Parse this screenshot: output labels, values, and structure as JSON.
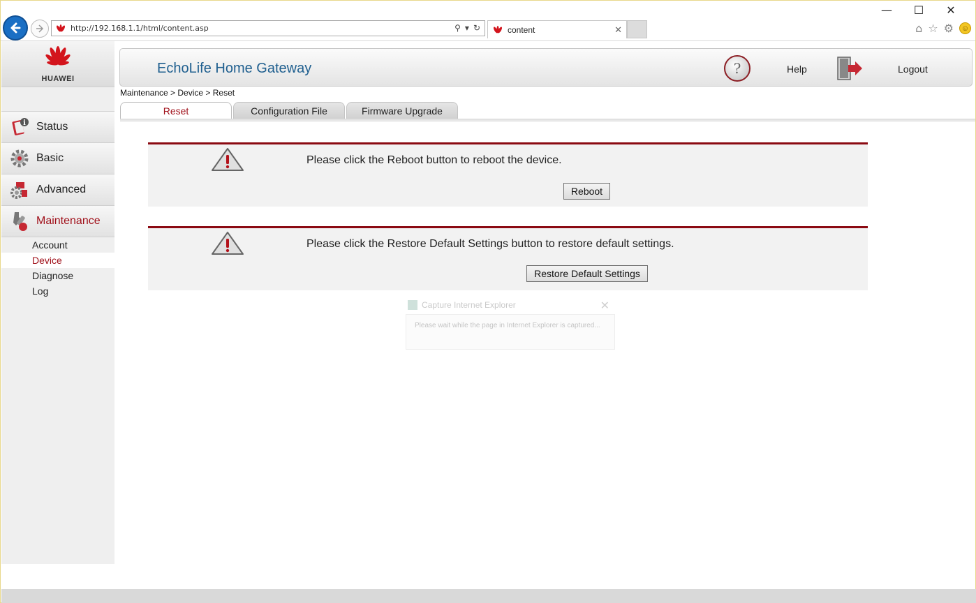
{
  "browser": {
    "url": "http://192.168.1.1/html/content.asp",
    "tab_title": "content",
    "tab_close": "✕",
    "win_minimize": "—",
    "win_maximize": "☐",
    "win_close": "✕"
  },
  "header": {
    "title": "EchoLife Home Gateway",
    "help_label": "Help",
    "logout_label": "Logout"
  },
  "logo": {
    "brand": "HUAWEI"
  },
  "sidebar": {
    "items": [
      {
        "label": "Status",
        "icon": "status-icon"
      },
      {
        "label": "Basic",
        "icon": "gear-icon"
      },
      {
        "label": "Advanced",
        "icon": "advanced-icon"
      },
      {
        "label": "Maintenance",
        "icon": "wrench-icon",
        "active": true
      }
    ],
    "submenu": [
      {
        "label": "Account"
      },
      {
        "label": "Device",
        "active": true
      },
      {
        "label": "Diagnose"
      },
      {
        "label": "Log"
      }
    ]
  },
  "breadcrumb": "Maintenance > Device > Reset",
  "tabs": [
    {
      "label": "Reset",
      "active": true
    },
    {
      "label": "Configuration File"
    },
    {
      "label": "Firmware Upgrade"
    }
  ],
  "panels": [
    {
      "message": "Please click the Reboot button to reboot the device.",
      "button": "Reboot"
    },
    {
      "message": "Please click the Restore Default Settings button to restore default settings.",
      "button": "Restore Default Settings"
    }
  ],
  "capture_dialog": {
    "title": "Capture Internet Explorer",
    "body": "Please wait while the page in Internet Explorer is captured..."
  },
  "colors": {
    "accent": "#a0101a",
    "panel_border": "#8b0a12",
    "title_blue": "#1f5f8f"
  }
}
